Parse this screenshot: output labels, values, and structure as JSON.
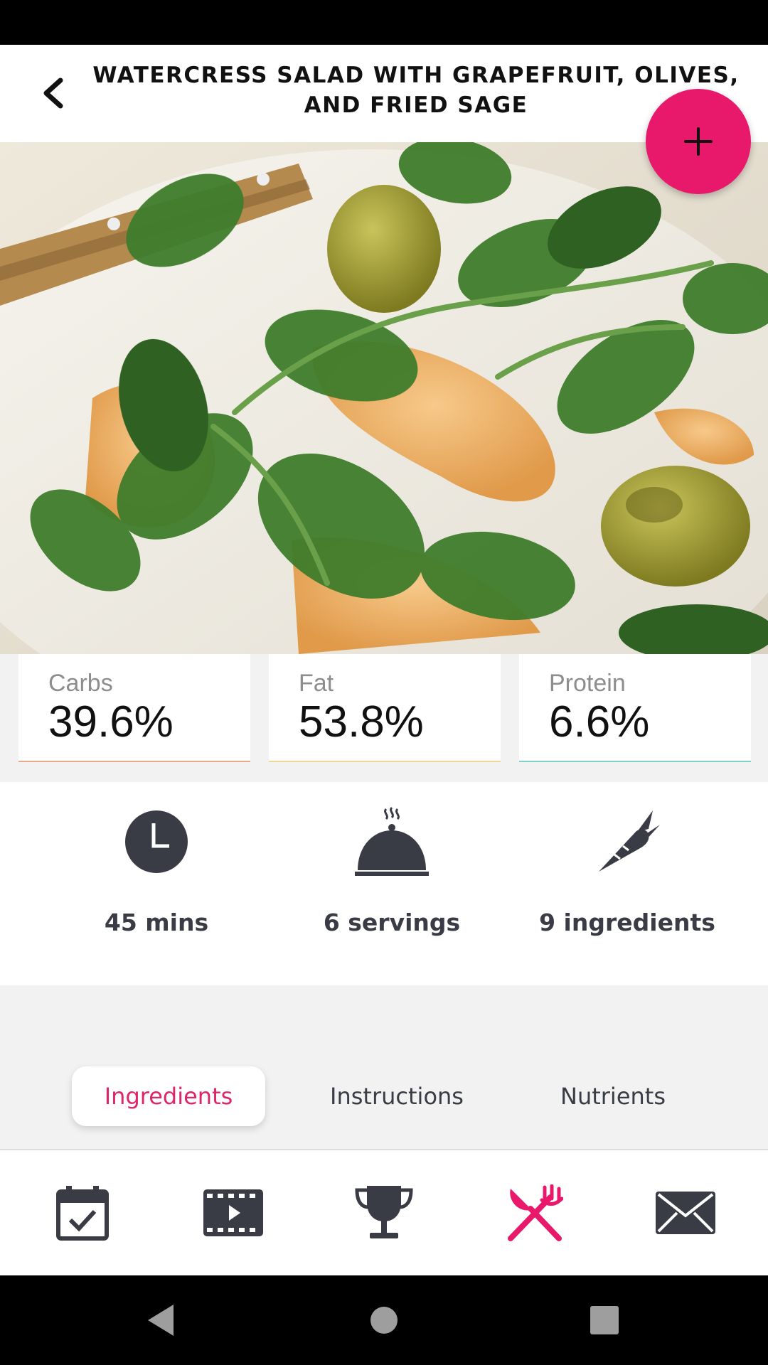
{
  "header": {
    "title": "WATERCRESS SALAD WITH GRAPEFRUIT, OLIVES,\nAND FRIED SAGE"
  },
  "fab": {
    "label": "+"
  },
  "macros": [
    {
      "label": "Carbs",
      "value": "39.6%",
      "color": "#e8a88c"
    },
    {
      "label": "Fat",
      "value": "53.8%",
      "color": "#f3d79a"
    },
    {
      "label": "Protein",
      "value": "6.6%",
      "color": "#7fd3c9"
    }
  ],
  "stats": {
    "time": "45 mins",
    "servings": "6 servings",
    "ingredients": "9 ingredients"
  },
  "tabs": [
    {
      "label": "Ingredients",
      "active": true
    },
    {
      "label": "Instructions",
      "active": false
    },
    {
      "label": "Nutrients",
      "active": false
    }
  ],
  "bottom_nav": [
    {
      "icon": "calendar-check-icon",
      "active": false
    },
    {
      "icon": "film-play-icon",
      "active": false
    },
    {
      "icon": "trophy-icon",
      "active": false
    },
    {
      "icon": "utensils-crossed-icon",
      "active": true
    },
    {
      "icon": "envelope-icon",
      "active": false
    }
  ],
  "colors": {
    "accent": "#e8196a",
    "active_tab_text": "#e0246a",
    "icon_dark": "#3a3c45"
  }
}
